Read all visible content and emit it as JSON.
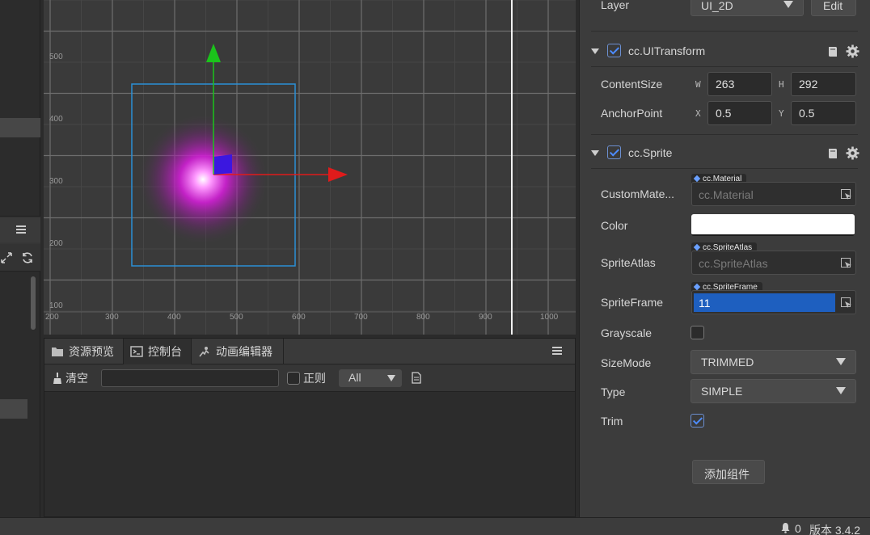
{
  "scene": {
    "ruler_x": [
      "200",
      "300",
      "400",
      "500",
      "600",
      "700",
      "800",
      "900",
      "1000"
    ],
    "ruler_y": [
      "500",
      "400",
      "300",
      "200",
      "100"
    ]
  },
  "console": {
    "tabs": [
      {
        "label": "资源预览",
        "icon": "folder-icon"
      },
      {
        "label": "控制台",
        "icon": "terminal-icon"
      },
      {
        "label": "动画编辑器",
        "icon": "animation-icon"
      }
    ],
    "clear_label": "清空",
    "search_value": "",
    "regex_label": "正则",
    "level_value": "All"
  },
  "inspector": {
    "layer": {
      "label": "Layer",
      "value": "UI_2D",
      "edit_label": "Edit"
    },
    "ui_transform": {
      "title": "cc.UITransform",
      "enabled": true,
      "content_size": {
        "label": "ContentSize",
        "w_tag": "W",
        "w": "263",
        "h_tag": "H",
        "h": "292"
      },
      "anchor_point": {
        "label": "AnchorPoint",
        "x_tag": "X",
        "x": "0.5",
        "y_tag": "Y",
        "y": "0.5"
      }
    },
    "sprite": {
      "title": "cc.Sprite",
      "enabled": true,
      "custom_material": {
        "label": "CustomMate...",
        "tag": "cc.Material",
        "placeholder": "cc.Material"
      },
      "color": {
        "label": "Color",
        "value": "#ffffff"
      },
      "sprite_atlas": {
        "label": "SpriteAtlas",
        "tag": "cc.SpriteAtlas",
        "placeholder": "cc.SpriteAtlas"
      },
      "sprite_frame": {
        "label": "SpriteFrame",
        "tag": "cc.SpriteFrame",
        "value": "11"
      },
      "grayscale": {
        "label": "Grayscale",
        "checked": false
      },
      "size_mode": {
        "label": "SizeMode",
        "value": "TRIMMED"
      },
      "type": {
        "label": "Type",
        "value": "SIMPLE"
      },
      "trim": {
        "label": "Trim",
        "checked": true
      }
    },
    "add_component_label": "添加组件"
  },
  "status": {
    "notifications": "0",
    "version": "版本 3.4.2"
  },
  "colors": {
    "accent": "#1e5fbf",
    "gizmo_x": "#e01b1b",
    "gizmo_y": "#1bc31b",
    "selection_rect": "#2a8fd6"
  }
}
